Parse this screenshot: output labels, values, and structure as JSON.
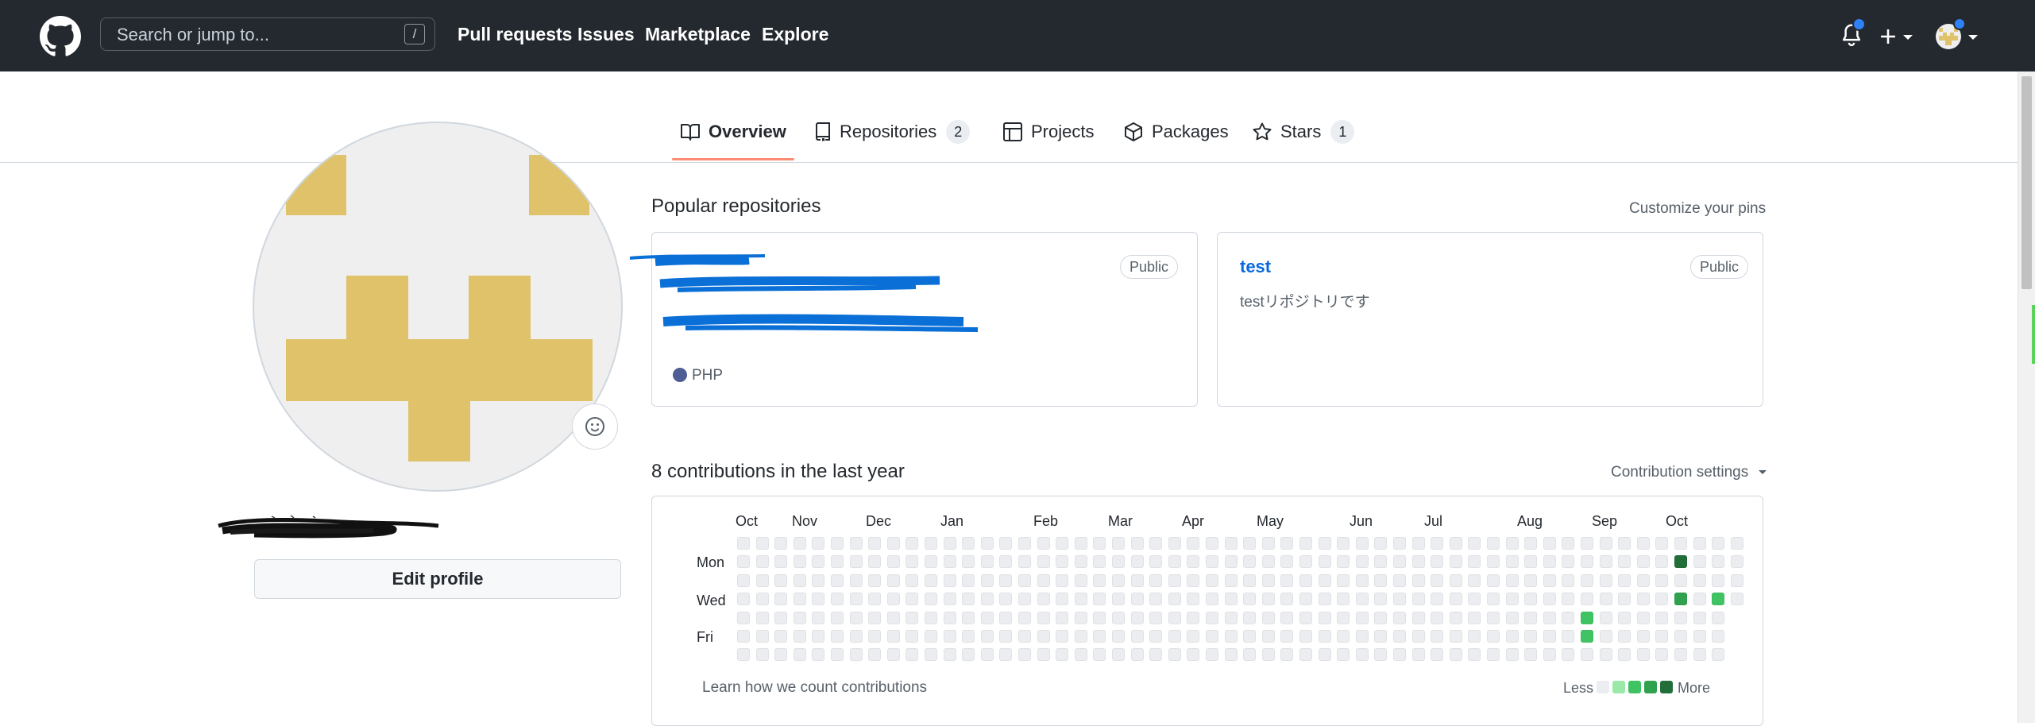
{
  "header": {
    "search_placeholder": "Search or jump to...",
    "search_shortcut": "/",
    "nav": [
      "Pull requests",
      "Issues",
      "Marketplace",
      "Explore"
    ],
    "icons": [
      "github-logo-icon",
      "bell-icon",
      "plus-icon",
      "caret-down-icon",
      "avatar-icon"
    ]
  },
  "tabs": [
    {
      "label": "Overview",
      "icon": "book-icon",
      "selected": true
    },
    {
      "label": "Repositories",
      "icon": "repo-icon",
      "count": "2"
    },
    {
      "label": "Projects",
      "icon": "table-icon"
    },
    {
      "label": "Packages",
      "icon": "package-icon"
    },
    {
      "label": "Stars",
      "icon": "star-icon",
      "count": "1"
    }
  ],
  "profile": {
    "edit_label": "Edit profile",
    "avatar_color": "#dfc26a"
  },
  "popular": {
    "title": "Popular repositories",
    "customize": "Customize your pins",
    "repos": [
      {
        "name": "",
        "visibility": "Public",
        "description": "",
        "language": "PHP",
        "language_color": "#4f5d95"
      },
      {
        "name": "test",
        "visibility": "Public",
        "description": "testリポジトリです"
      }
    ]
  },
  "contributions": {
    "title": "8 contributions in the last year",
    "settings": "Contribution settings",
    "months": [
      "Oct",
      "Nov",
      "Dec",
      "Jan",
      "Feb",
      "Mar",
      "Apr",
      "May",
      "Jun",
      "Jul",
      "Aug",
      "Sep",
      "Oct"
    ],
    "day_labels": [
      "Mon",
      "Wed",
      "Fri"
    ],
    "learn": "Learn how we count contributions",
    "legend_less": "Less",
    "legend_more": "More",
    "level_colors": [
      "#ebedf0",
      "#9be9a8",
      "#40c463",
      "#30a14e",
      "#216e39"
    ],
    "active_days": [
      {
        "week": 45,
        "day": 4,
        "level": 2
      },
      {
        "week": 45,
        "day": 5,
        "level": 2
      },
      {
        "week": 50,
        "day": 1,
        "level": 4
      },
      {
        "week": 50,
        "day": 3,
        "level": 3
      },
      {
        "week": 52,
        "day": 3,
        "level": 2
      }
    ]
  }
}
